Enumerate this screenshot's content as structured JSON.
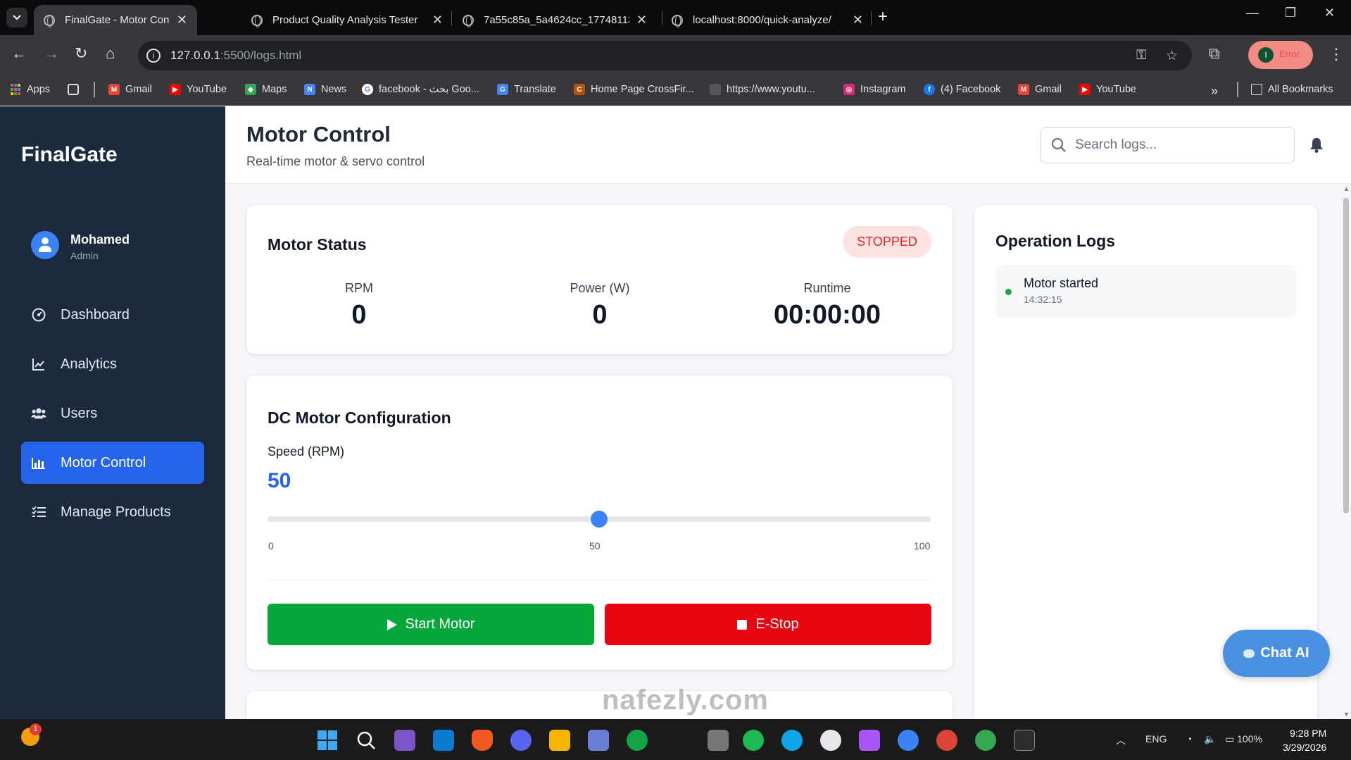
{
  "browser": {
    "tabs": [
      {
        "title": "FinalGate - Motor Control",
        "active": true
      },
      {
        "title": "Product Quality Analysis Tester",
        "active": false
      },
      {
        "title": "7a55c85a_5a4624cc_177481132…",
        "active": false
      },
      {
        "title": "localhost:8000/quick-analyze/",
        "active": false
      }
    ],
    "url_host": "127.0.0.1",
    "url_rest": ":5500/logs.html",
    "profile_initial": "I",
    "profile_status": "Error",
    "bookmarks": [
      {
        "label": "Apps",
        "icon": "apps-grid-icon"
      },
      {
        "label": "",
        "icon": "google-apps-icon"
      },
      {
        "label": "Gmail",
        "icon": "gmail-icon",
        "color": "#ea4335"
      },
      {
        "label": "YouTube",
        "icon": "youtube-icon",
        "color": "#ff0000"
      },
      {
        "label": "Maps",
        "icon": "maps-icon",
        "color": "#34a853"
      },
      {
        "label": "News",
        "icon": "news-icon",
        "color": "#4285f4"
      },
      {
        "label": "facebook - بحث Goo...",
        "icon": "google-icon",
        "color": "#4285f4"
      },
      {
        "label": "Translate",
        "icon": "translate-icon",
        "color": "#4285f4"
      },
      {
        "label": "Home Page CrossFir...",
        "icon": "crossfire-icon",
        "color": "#b45309"
      },
      {
        "label": "https://www.youtu...",
        "icon": "globe-icon",
        "color": "#555555"
      },
      {
        "label": "Instagram",
        "icon": "instagram-icon",
        "color": "#d62976"
      },
      {
        "label": "(4) Facebook",
        "icon": "facebook-icon",
        "color": "#1877f2"
      },
      {
        "label": "Gmail",
        "icon": "gmail-icon",
        "color": "#ea4335"
      },
      {
        "label": "YouTube",
        "icon": "youtube-icon",
        "color": "#ff0000"
      }
    ],
    "all_bookmarks": "All Bookmarks"
  },
  "sidebar": {
    "brand": "FinalGate",
    "user": {
      "name": "Mohamed",
      "role": "Admin"
    },
    "items": [
      {
        "label": "Dashboard",
        "icon": "dashboard-icon",
        "active": false
      },
      {
        "label": "Analytics",
        "icon": "chart-line-icon",
        "active": false
      },
      {
        "label": "Users",
        "icon": "users-icon",
        "active": false
      },
      {
        "label": "Motor Control",
        "icon": "motor-chart-icon",
        "active": true
      },
      {
        "label": "Manage Products",
        "icon": "list-icon",
        "active": false
      }
    ]
  },
  "header": {
    "title": "Motor Control",
    "subtitle": "Real-time motor & servo control",
    "search_placeholder": "Search logs..."
  },
  "motor_status": {
    "title": "Motor Status",
    "status": "STOPPED",
    "stats": [
      {
        "label": "RPM",
        "value": "0"
      },
      {
        "label": "Power (W)",
        "value": "0"
      },
      {
        "label": "Runtime",
        "value": "00:00:00"
      }
    ]
  },
  "dc_config": {
    "title": "DC Motor Configuration",
    "speed_label": "Speed (RPM)",
    "speed_value": "50",
    "slider": {
      "min": 0,
      "max": 100,
      "value": 50
    },
    "ticks": [
      "0",
      "50",
      "100"
    ],
    "start_label": "Start Motor",
    "stop_label": "E-Stop"
  },
  "operation_logs": {
    "title": "Operation Logs",
    "entries": [
      {
        "message": "Motor started",
        "time": "14:32:15",
        "status_color": "#16a34a"
      }
    ]
  },
  "chat": {
    "label": "Chat AI"
  },
  "watermark": "nafezly.com",
  "colors": {
    "sidebar_bg": "#1c2a3e",
    "accent": "#2563eb",
    "start": "#05a63a",
    "stop": "#e60510",
    "stopped_badge_bg": "#fde2e2",
    "stopped_badge_text": "#dc2626",
    "chat": "#4a90e2"
  },
  "taskbar": {
    "notification_count": "1",
    "language": "ENG",
    "battery": "100%",
    "time": "9:28 PM",
    "date": "3/29/2026"
  }
}
